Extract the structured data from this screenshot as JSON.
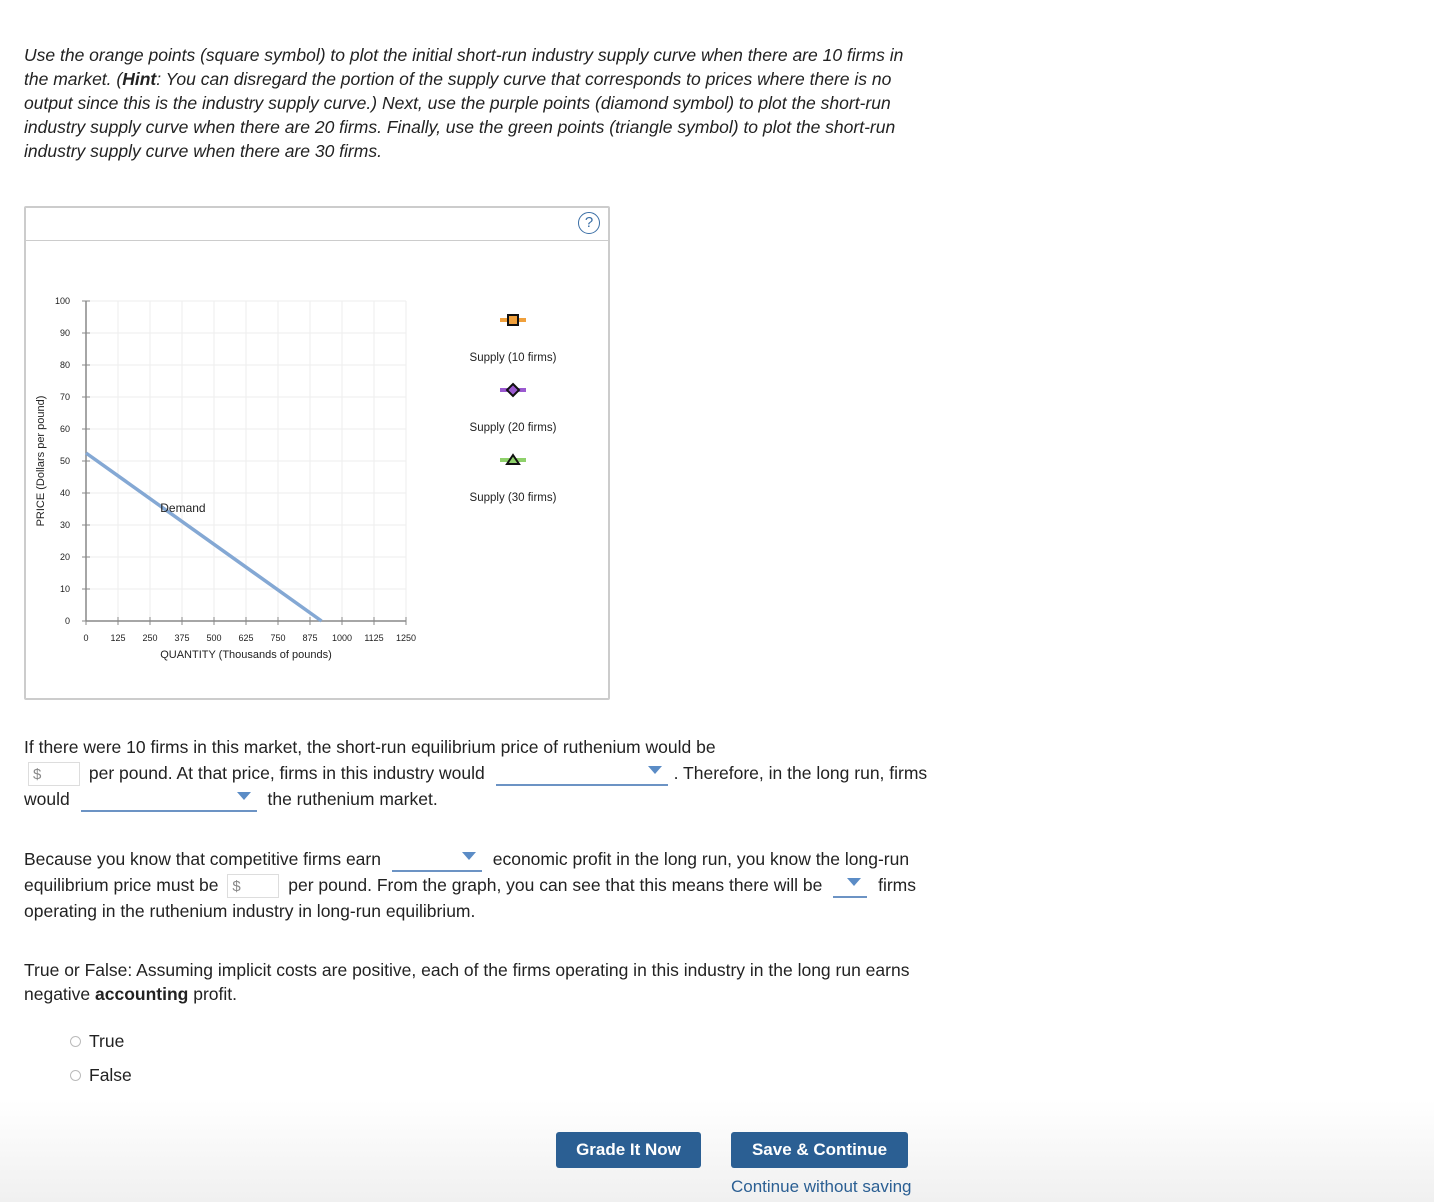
{
  "instructions": {
    "part1": "Use the orange points (square symbol) to plot the initial short-run industry supply curve when there are 10 firms in the market. (",
    "hint_bold": "Hint",
    "part2": ": You can disregard the portion of the supply curve that corresponds to prices where there is no output since this is the industry supply curve.) Next, use the purple points (diamond symbol) to plot the short-run industry supply curve when there are 20 firms. Finally, use the green points (triangle symbol) to plot the short-run industry supply curve when there are 30 firms."
  },
  "help_icon": "?",
  "chart_data": {
    "type": "line",
    "xlabel": "QUANTITY (Thousands of pounds)",
    "ylabel": "PRICE (Dollars per pound)",
    "xlim": [
      0,
      1250
    ],
    "ylim": [
      0,
      100
    ],
    "xticks": [
      "0",
      "125",
      "250",
      "375",
      "500",
      "625",
      "750",
      "875",
      "1000",
      "1125",
      "1250"
    ],
    "yticks": [
      "0",
      "10",
      "20",
      "30",
      "40",
      "50",
      "60",
      "70",
      "80",
      "90",
      "100"
    ],
    "grid": true,
    "series": [
      {
        "name": "Demand",
        "color": "#84a8d4",
        "points": [
          [
            0,
            52.5
          ],
          [
            920,
            0
          ]
        ]
      }
    ],
    "legend": [
      {
        "name": "Supply (10 firms)",
        "symbol": "square",
        "color": "#f0a03c"
      },
      {
        "name": "Supply (20 firms)",
        "symbol": "diamond",
        "color": "#9b59d0"
      },
      {
        "name": "Supply (30 firms)",
        "symbol": "triangle",
        "color": "#8fd16b"
      }
    ],
    "legend_placement": "right"
  },
  "q1": {
    "t1": "If there were 10 firms in this market, the short-run equilibrium price of ruthenium would be",
    "currency": "$",
    "t2": "per pound. At that price, firms in this industry would",
    "t3": ". Therefore, in the long run, firms would",
    "t4": "the ruthenium market."
  },
  "q2": {
    "t1": "Because you know that competitive firms earn",
    "t2": "economic profit in the long run, you know the long-run equilibrium price must be",
    "currency": "$",
    "t3": "per pound. From the graph, you can see that this means there will be",
    "t4": "firms operating in the ruthenium industry in long-run equilibrium."
  },
  "q3": {
    "t1": "True or False: Assuming implicit costs are positive, each of the firms operating in this industry in the long run earns negative ",
    "bold": "accounting",
    "t2": " profit.",
    "options": [
      "True",
      "False"
    ]
  },
  "footer": {
    "grade": "Grade It Now",
    "save": "Save & Continue",
    "continue": "Continue without saving"
  }
}
